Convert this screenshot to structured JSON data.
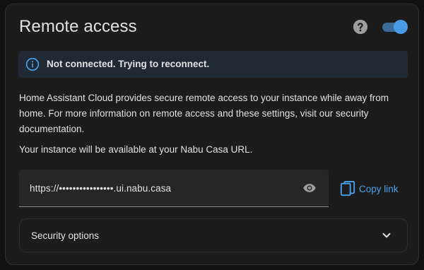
{
  "card": {
    "title": "Remote access",
    "help_icon": "help-circle-icon",
    "toggle": {
      "state": "on",
      "color": "#4a9be6"
    }
  },
  "alert": {
    "icon": "info-circle-icon",
    "text": "Not connected. Trying to reconnect.",
    "background": "#1f2a35"
  },
  "description": "Home Assistant Cloud provides secure remote access to your instance while away from home. For more information on remote access and these settings, visit our security documentation.",
  "instance_note": "Your instance will be available at your Nabu Casa URL.",
  "url_field": {
    "value": "https://••••••••••••••••.ui.nabu.casa",
    "reveal_icon": "eye-icon"
  },
  "copy_link": {
    "label": "Copy link",
    "icon": "copy-icon",
    "color": "#4aa2ea"
  },
  "security_options": {
    "label": "Security options",
    "icon": "chevron-down-icon",
    "expanded": false
  }
}
